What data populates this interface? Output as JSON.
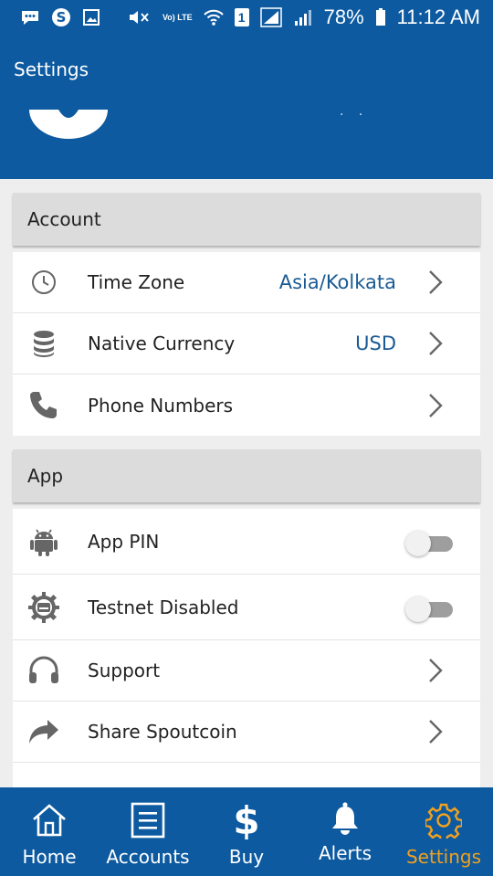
{
  "status_bar": {
    "battery": "78%",
    "time": "11:12 AM",
    "left_icons": [
      "message-icon",
      "skype-icon",
      "gallery-icon"
    ],
    "right_icons": [
      "mute-icon",
      "volte-icon",
      "wifi-icon",
      "sim1-icon",
      "signal-icon",
      "signal2-icon",
      "battery-icon"
    ],
    "volte_label": "Vo) LTE",
    "sim_label": "1"
  },
  "header": {
    "title": "Settings",
    "dots": "· ·"
  },
  "sections": {
    "account": {
      "title": "Account",
      "rows": [
        {
          "label": "Time Zone",
          "value": "Asia/Kolkata",
          "icon": "clock-icon"
        },
        {
          "label": "Native Currency",
          "value": "USD",
          "icon": "coin-stack-icon"
        },
        {
          "label": "Phone Numbers",
          "value": "",
          "icon": "phone-icon"
        }
      ]
    },
    "app": {
      "title": "App",
      "rows": [
        {
          "label": "App PIN",
          "icon": "android-icon",
          "toggle": false
        },
        {
          "label": "Testnet Disabled",
          "icon": "testnet-gear-icon",
          "toggle": false
        },
        {
          "label": "Support",
          "icon": "headset-icon"
        },
        {
          "label": "Share Spoutcoin",
          "icon": "share-arrow-icon"
        }
      ]
    }
  },
  "bottom_nav": {
    "items": [
      {
        "label": "Home",
        "icon": "home-icon",
        "active": false
      },
      {
        "label": "Accounts",
        "icon": "list-icon",
        "active": false
      },
      {
        "label": "Buy",
        "icon": "dollar-icon",
        "active": false
      },
      {
        "label": "Alerts",
        "icon": "bell-icon",
        "active": false
      },
      {
        "label": "Settings",
        "icon": "gear-icon",
        "active": true
      }
    ],
    "active_color": "#f0a020",
    "inactive_color": "#ffffff"
  },
  "colors": {
    "primary": "#0d5aa0",
    "value_text": "#1a5a93",
    "section_bg": "#dcdcdc"
  }
}
